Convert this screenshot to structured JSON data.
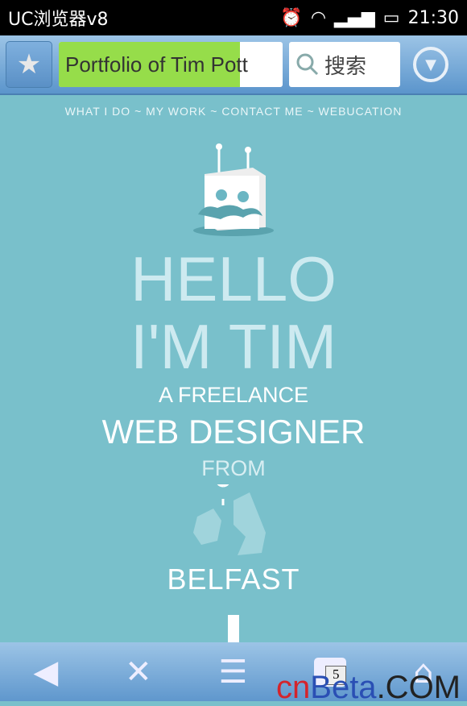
{
  "status": {
    "app": "UC浏览器v8",
    "time": "21:30"
  },
  "toolbar": {
    "url_title": "Portfolio of Tim Pott",
    "load_progress": 0.81,
    "search_placeholder": "搜索"
  },
  "nav": {
    "items": [
      "WHAT I DO",
      "MY WORK",
      "CONTACT ME",
      "WEBUCATION"
    ],
    "sep": "~"
  },
  "hero": {
    "hello": "HELLO",
    "im": "I'M TIM",
    "line1": "A FREELANCE",
    "line2": "WEB DESIGNER",
    "line3": "FROM",
    "city": "BELFAST"
  },
  "bottom": {
    "tab_count": "5"
  },
  "watermark": {
    "cn": "cn",
    "beta": "Beta",
    ".com": ".COM"
  },
  "colors": {
    "bg": "#79c0cb",
    "progress": "#96dd4a"
  }
}
